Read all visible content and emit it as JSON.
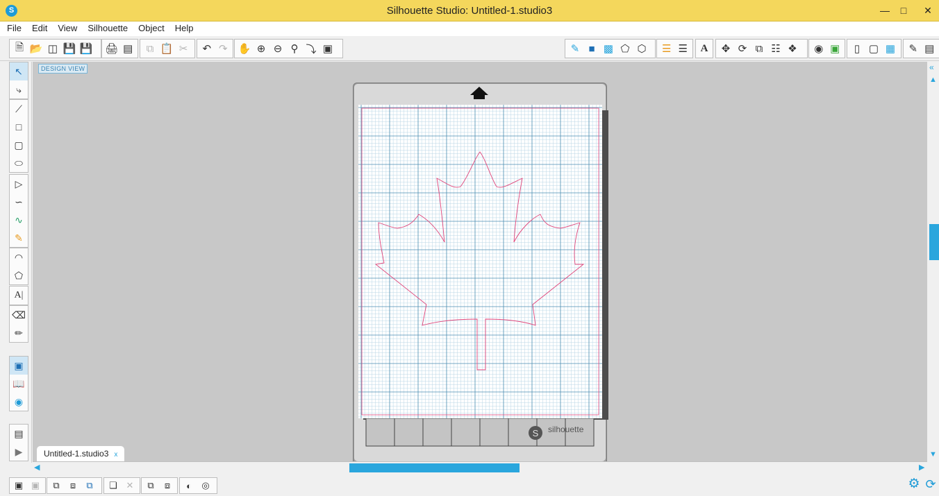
{
  "window": {
    "title": "Silhouette Studio: Untitled-1.studio3",
    "app_icon": "S"
  },
  "menu": [
    "File",
    "Edit",
    "View",
    "Silhouette",
    "Object",
    "Help"
  ],
  "canvas": {
    "view_label": "DESIGN VIEW"
  },
  "mat": {
    "brand": "silhouette",
    "logo_letter": "S"
  },
  "document_tab": {
    "label": "Untitled-1.studio3",
    "close": "x"
  },
  "colors": {
    "accent": "#2aa6dd",
    "title_bar": "#f4d75c",
    "canvas_bg": "#c8c8c8",
    "grid_line": "#5b9ab8",
    "cut_line": "#e0457a"
  }
}
